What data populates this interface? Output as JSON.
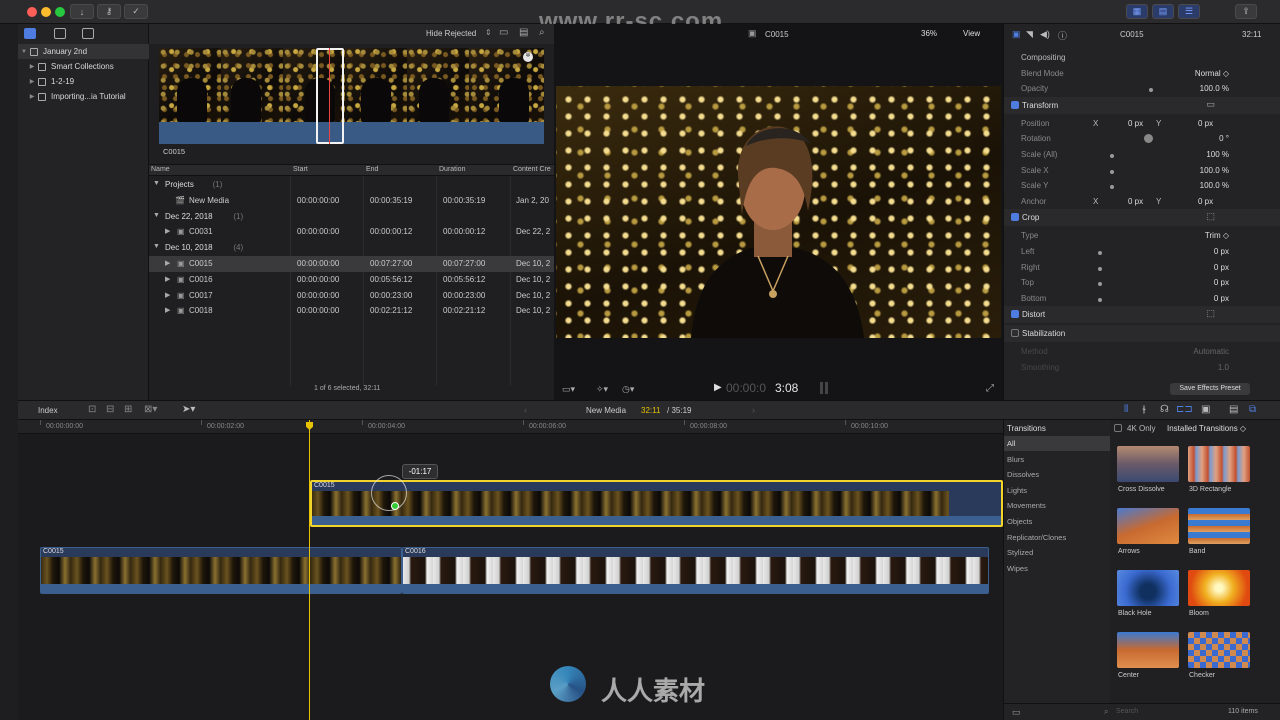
{
  "toolbar": {
    "hide_rejected": "Hide Rejected",
    "clip_name": "C0015",
    "zoom": "36%",
    "view": "View",
    "inspector_title": "C0015",
    "inspector_duration": "32:11"
  },
  "watermark": "www.rr-sc.com",
  "libraries": {
    "items": [
      {
        "label": "January 2nd",
        "level": 0
      },
      {
        "label": "Smart Collections",
        "level": 1
      },
      {
        "label": "1-2-19",
        "level": 1
      },
      {
        "label": "Importing...ia Tutorial",
        "level": 1
      }
    ]
  },
  "browser": {
    "filmstrip_label": "C0015",
    "columns": [
      "Name",
      "Start",
      "End",
      "Duration",
      "Content Cre"
    ],
    "rows": [
      {
        "type": "group",
        "name": "Projects",
        "count": "(1)"
      },
      {
        "type": "item",
        "name": "New Media",
        "start": "00:00:00:00",
        "end": "00:00:35:19",
        "duration": "00:00:35:19",
        "content": "Jan 2, 20"
      },
      {
        "type": "group",
        "name": "Dec 22, 2018",
        "count": "(1)"
      },
      {
        "type": "item",
        "name": "C0031",
        "start": "00:00:00:00",
        "end": "00:00:00:12",
        "duration": "00:00:00:12",
        "content": "Dec 22, 2"
      },
      {
        "type": "group",
        "name": "Dec 10, 2018",
        "count": "(4)"
      },
      {
        "type": "item",
        "name": "C0015",
        "start": "00:00:00:00",
        "end": "00:07:27:00",
        "duration": "00:07:27:00",
        "content": "Dec 10, 2",
        "selected": true
      },
      {
        "type": "item",
        "name": "C0016",
        "start": "00:00:00:00",
        "end": "00:05:56:12",
        "duration": "00:05:56:12",
        "content": "Dec 10, 2"
      },
      {
        "type": "item",
        "name": "C0017",
        "start": "00:00:00:00",
        "end": "00:00:23:00",
        "duration": "00:00:23:00",
        "content": "Dec 10, 2"
      },
      {
        "type": "item",
        "name": "C0018",
        "start": "00:00:00:00",
        "end": "00:02:21:12",
        "duration": "00:02:21:12",
        "content": "Dec 10, 2"
      }
    ],
    "status": "1 of 6 selected, 32:11"
  },
  "viewer": {
    "timecode": "3:08",
    "timecode_dim": "00:00:0"
  },
  "inspector": {
    "rows": [
      {
        "kind": "header",
        "label": "Compositing"
      },
      {
        "kind": "prop",
        "label": "Blend Mode",
        "value": "Normal ◇"
      },
      {
        "kind": "prop",
        "label": "Opacity",
        "value": "100.0 %"
      },
      {
        "kind": "section",
        "label": "Transform",
        "checked": true
      },
      {
        "kind": "xy",
        "label": "Position",
        "x": "0 px",
        "y": "0 px"
      },
      {
        "kind": "prop",
        "label": "Rotation",
        "value": "0 °"
      },
      {
        "kind": "prop",
        "label": "Scale (All)",
        "value": "100 %"
      },
      {
        "kind": "prop",
        "label": "Scale X",
        "value": "100.0 %"
      },
      {
        "kind": "prop",
        "label": "Scale Y",
        "value": "100.0 %"
      },
      {
        "kind": "xy",
        "label": "Anchor",
        "x": "0 px",
        "y": "0 px"
      },
      {
        "kind": "section",
        "label": "Crop",
        "checked": true
      },
      {
        "kind": "prop",
        "label": "Type",
        "value": "Trim ◇"
      },
      {
        "kind": "prop",
        "label": "Left",
        "value": "0 px"
      },
      {
        "kind": "prop",
        "label": "Right",
        "value": "0 px"
      },
      {
        "kind": "prop",
        "label": "Top",
        "value": "0 px"
      },
      {
        "kind": "prop",
        "label": "Bottom",
        "value": "0 px"
      },
      {
        "kind": "section",
        "label": "Distort",
        "checked": true
      },
      {
        "kind": "section",
        "label": "Stabilization",
        "checked": false
      },
      {
        "kind": "dim",
        "label": "Method",
        "value": "Automatic"
      },
      {
        "kind": "dim",
        "label": "Smoothing",
        "value": "1.0"
      }
    ],
    "save_preset": "Save Effects Preset"
  },
  "timeline_bar": {
    "index": "Index",
    "project": "New Media",
    "position": "32:11",
    "total": "/ 35:19"
  },
  "ruler": [
    "00:00:00:00",
    "00:00:02:00",
    "00:00:04:00",
    "00:00:06:00",
    "00:00:08:00",
    "00:00:10:00"
  ],
  "timeline": {
    "trim_badge": "-01:17",
    "clip_connected": "C0015",
    "clip_primary_a": "C0015",
    "clip_primary_b": "C0016"
  },
  "transitions": {
    "title": "Transitions",
    "filter_4k": "4K Only",
    "installed": "Installed Transitions ◇",
    "categories": [
      "All",
      "Blurs",
      "Dissolves",
      "Lights",
      "Movements",
      "Objects",
      "Replicator/Clones",
      "Stylized",
      "Wipes"
    ],
    "items": [
      "Cross Dissolve",
      "3D Rectangle",
      "Arrows",
      "Band",
      "Black Hole",
      "Bloom",
      "Center",
      "Checker"
    ],
    "count": "110 items",
    "search_placeholder": "Search"
  },
  "brand_watermark": "人人素材",
  "colors": {
    "accent_blue": "#4e7ce0",
    "playhead": "#e6c200",
    "selection_yellow": "#f2d42a",
    "audio_blue": "#3b5f8f"
  }
}
